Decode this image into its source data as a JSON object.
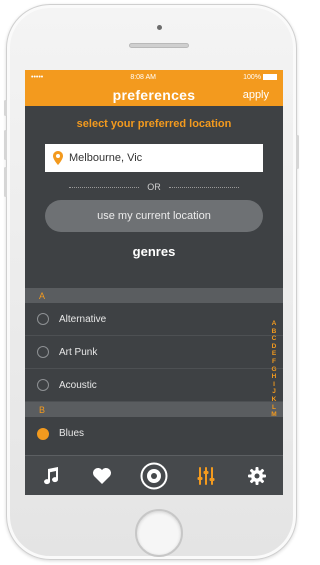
{
  "status": {
    "carrier": "•••••",
    "time": "8:08 AM",
    "battery": "100%"
  },
  "navbar": {
    "title": "preferences",
    "apply_label": "apply"
  },
  "location": {
    "heading": "select your preferred location",
    "value": "Melbourne, Vic",
    "or_label": "OR",
    "use_current_label": "use my current location"
  },
  "genres": {
    "title": "genres",
    "sections": [
      {
        "letter": "A",
        "items": [
          {
            "label": "Alternative",
            "selected": false
          },
          {
            "label": "Art Punk",
            "selected": false
          },
          {
            "label": "Acoustic",
            "selected": false
          }
        ]
      },
      {
        "letter": "B",
        "items": [
          {
            "label": "Blues",
            "selected": true
          }
        ]
      }
    ],
    "alphabet": [
      "A",
      "B",
      "C",
      "D",
      "E",
      "F",
      "G",
      "H",
      "I",
      "J",
      "K",
      "L",
      "M"
    ]
  },
  "tabbar": {
    "tabs": [
      {
        "icon": "music-note-icon",
        "active": false
      },
      {
        "icon": "heart-icon",
        "active": false
      },
      {
        "icon": "record-icon",
        "active": false
      },
      {
        "icon": "equalizer-icon",
        "active": true
      },
      {
        "icon": "gear-icon",
        "active": false
      }
    ]
  },
  "colors": {
    "accent": "#f39a1e",
    "background": "#3e4144",
    "section": "#5a5d60"
  }
}
